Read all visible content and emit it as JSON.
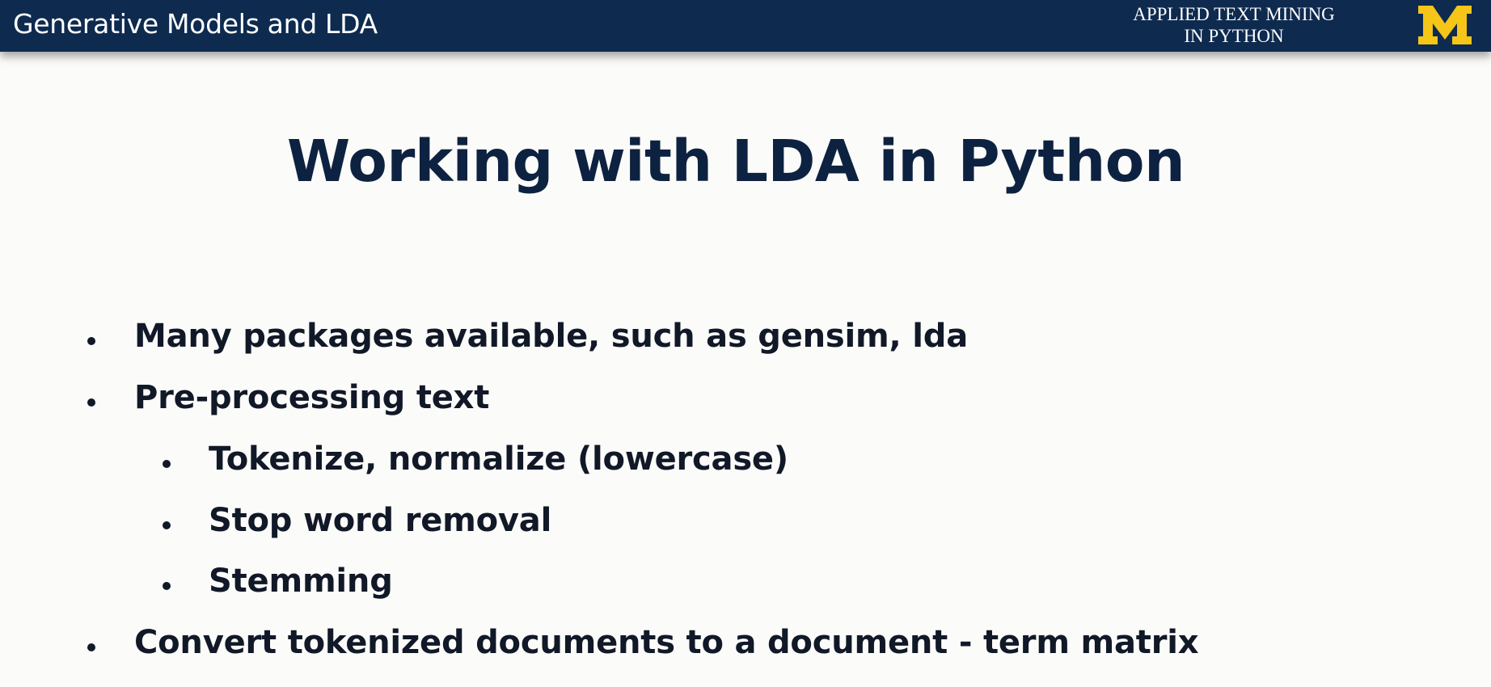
{
  "header": {
    "title": "Generative Models and LDA",
    "course_line1": "APPLIED TEXT MINING",
    "course_line2": "IN PYTHON",
    "logo_letter": "M",
    "bar_color": "#0e2a4f",
    "logo_color": "#f5c518"
  },
  "slide": {
    "title": "Working with LDA in Python",
    "bullets": [
      {
        "level": 1,
        "text": "Many packages available, such as gensim, lda"
      },
      {
        "level": 1,
        "text": "Pre-processing text"
      },
      {
        "level": 2,
        "text": "Tokenize, normalize (lowercase)"
      },
      {
        "level": 2,
        "text": "Stop word removal"
      },
      {
        "level": 2,
        "text": "Stemming"
      },
      {
        "level": 1,
        "text": "Convert tokenized documents to a document - term matrix"
      }
    ]
  }
}
